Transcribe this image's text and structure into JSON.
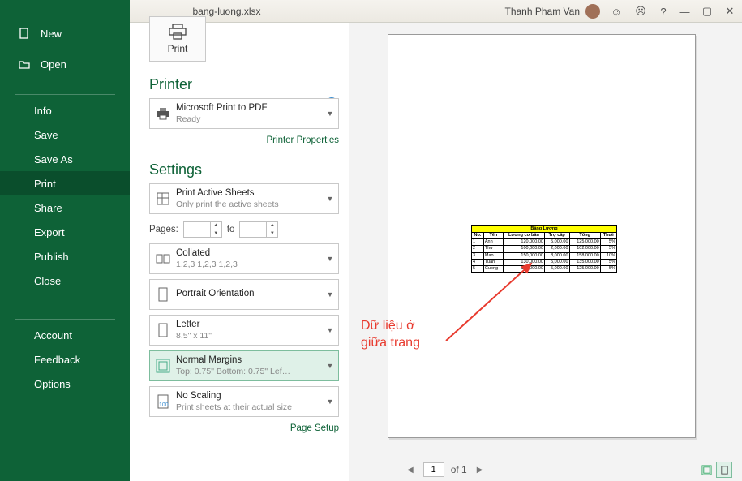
{
  "title": {
    "filename": "bang-luong.xlsx",
    "username": "Thanh Pham Van"
  },
  "sidebar": {
    "new": "New",
    "open": "Open",
    "info": "Info",
    "save": "Save",
    "saveas": "Save As",
    "print": "Print",
    "share": "Share",
    "export": "Export",
    "publish": "Publish",
    "close": "Close",
    "account": "Account",
    "feedback": "Feedback",
    "options": "Options"
  },
  "panel": {
    "print_label": "Print",
    "printer_heading": "Printer",
    "printer_name": "Microsoft Print to PDF",
    "printer_status": "Ready",
    "printer_props": "Printer Properties",
    "settings_heading": "Settings",
    "s_sheets_t": "Print Active Sheets",
    "s_sheets_d": "Only print the active sheets",
    "pages_label": "Pages:",
    "pages_to": "to",
    "s_collate_t": "Collated",
    "s_collate_d": "1,2,3    1,2,3    1,2,3",
    "s_orient_t": "Portrait Orientation",
    "s_paper_t": "Letter",
    "s_paper_d": "8.5\" x 11\"",
    "s_margin_t": "Normal Margins",
    "s_margin_d": "Top: 0.75\" Bottom: 0.75\" Lef…",
    "s_scale_t": "No Scaling",
    "s_scale_d": "Print sheets at their actual size",
    "page_setup": "Page Setup"
  },
  "preview": {
    "table_title": "Bảng Lương",
    "headers": [
      "No.",
      "Tên",
      "Lương cơ bản",
      "Trợ cấp",
      "Tổng",
      "Thuế"
    ],
    "rows": [
      [
        "1",
        "Anh",
        "120,000.00",
        "5,000.00",
        "125,000.00",
        "5%"
      ],
      [
        "2",
        "Thư",
        "100,000.00",
        "2,000.00",
        "102,000.00",
        "5%"
      ],
      [
        "3",
        "Mao",
        "150,000.00",
        "8,000.00",
        "158,000.00",
        "10%"
      ],
      [
        "4",
        "Tuan",
        "130,000.00",
        "5,000.00",
        "135,000.00",
        "5%"
      ],
      [
        "5",
        "Cuong",
        "120,000.00",
        "5,000.00",
        "125,000.00",
        "5%"
      ]
    ]
  },
  "annotation": {
    "l1": "Dữ liệu ở",
    "l2": "giữa trang"
  },
  "pager": {
    "cur": "1",
    "of": "of 1"
  }
}
